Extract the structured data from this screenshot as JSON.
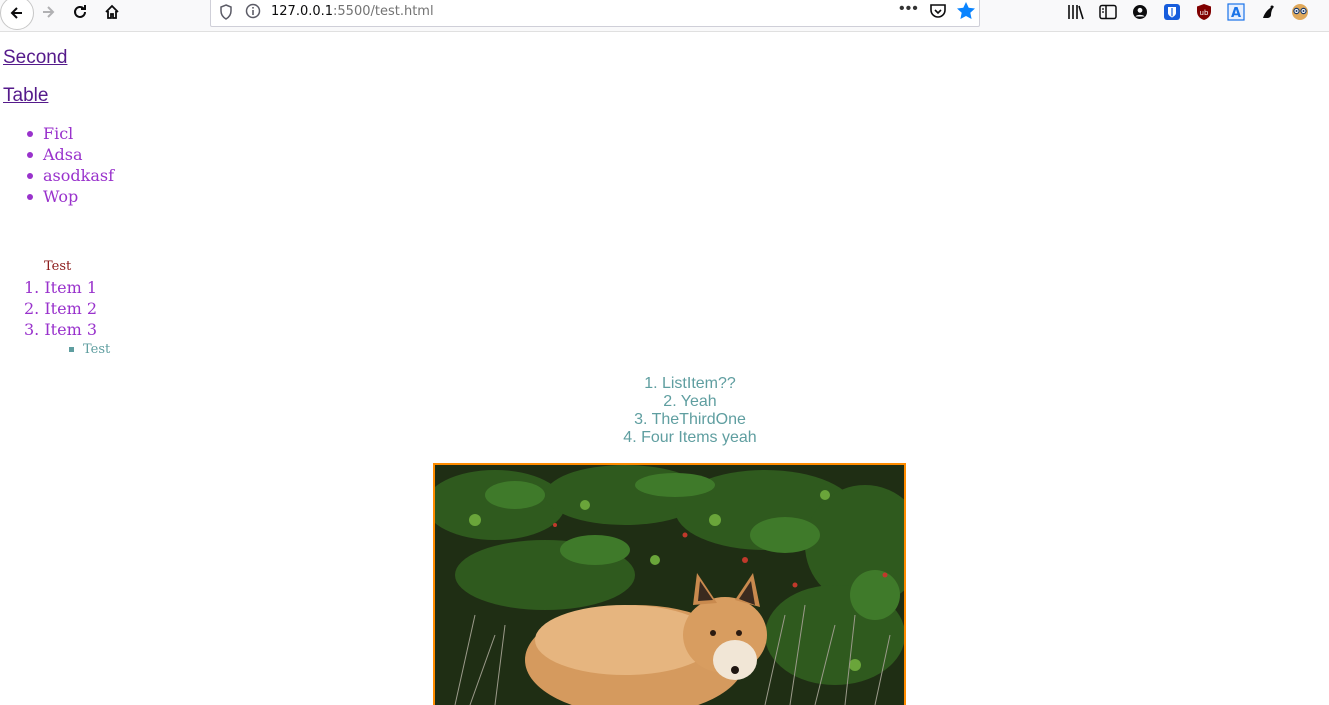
{
  "browser": {
    "url_host": "127.0.0.1",
    "url_rest": ":5500/test.html",
    "more_label": "•••",
    "icons": [
      "back-icon",
      "forward-icon",
      "reload-icon",
      "home-icon",
      "shield-icon",
      "info-icon",
      "pocket-icon",
      "bookmark-star-icon",
      "library-icon",
      "sidebar-icon",
      "account-icon",
      "bitwarden-icon",
      "ublock-icon",
      "translate-icon",
      "extension-icon",
      "extension-icon-2"
    ]
  },
  "page": {
    "links": [
      "Second",
      "Table"
    ],
    "bullet_items": [
      "Ficl",
      "Adsa",
      "asodkasf",
      "Wop"
    ],
    "ordered_caption": "Test",
    "ordered_items": [
      "1. Item 1",
      "2. Item 2",
      "3. Item 3"
    ],
    "nested_item": "Test",
    "centered_items": [
      "1. ListItem??",
      "2. Yeah",
      "3. TheThirdOne",
      "4. Four Items yeah"
    ],
    "image": {
      "subject": "fox-photo",
      "border_color": "#ff8c00"
    }
  },
  "colors": {
    "link": "#551a8b",
    "purple_text": "#9932cc",
    "teal_text": "#5f9ea0",
    "caption": "#8b1a1a",
    "accent_star": "#0a84ff"
  }
}
